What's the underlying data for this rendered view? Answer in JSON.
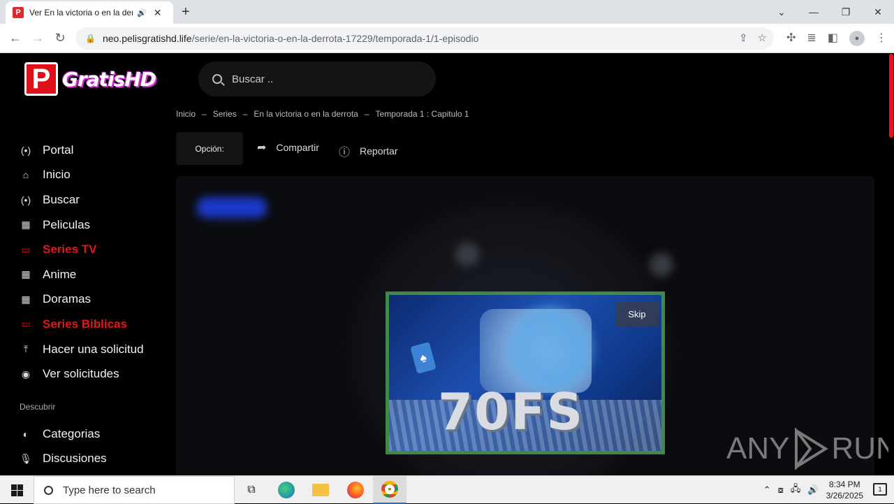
{
  "browser": {
    "tab_title": "Ver En la victoria o en la derrota",
    "favicon_letter": "P",
    "url_host": "neo.pelisgratishd.life",
    "url_path": "/serie/en-la-victoria-o-en-la-derrota-17229/temporada-1/1-episodio"
  },
  "site": {
    "logo_letter": "P",
    "logo_text": "GratisHD",
    "search_placeholder": "Buscar .."
  },
  "sidebar": {
    "items": [
      {
        "label": "Portal",
        "icon": "broadcast-icon",
        "glyph": "(•)"
      },
      {
        "label": "Inicio",
        "icon": "home-icon",
        "glyph": "⌂"
      },
      {
        "label": "Buscar",
        "icon": "broadcast-icon",
        "glyph": "(•)"
      },
      {
        "label": "Peliculas",
        "icon": "film-icon",
        "glyph": "▦"
      },
      {
        "label": "Series TV",
        "icon": "tv-icon",
        "glyph": "▭"
      },
      {
        "label": "Anime",
        "icon": "film-icon",
        "glyph": "▦"
      },
      {
        "label": "Doramas",
        "icon": "film-icon",
        "glyph": "▦"
      },
      {
        "label": "Series Biblicas",
        "icon": "tv-icon",
        "glyph": "▭"
      },
      {
        "label": "Hacer una solicitud",
        "icon": "upload-icon",
        "glyph": "⤒"
      },
      {
        "label": "Ver solicitudes",
        "icon": "eye-icon",
        "glyph": "◉"
      }
    ],
    "section_label": "Descubrir",
    "discover": [
      {
        "label": "Categorias",
        "icon": "half-circle-icon",
        "glyph": "◐"
      },
      {
        "label": "Discusiones",
        "icon": "microphone-icon",
        "glyph": "🎙"
      }
    ]
  },
  "breadcrumb": {
    "items": [
      "Inicio",
      "Series",
      "En la victoria o en la derrota",
      "Temporada 1 : Capitulo 1"
    ],
    "separator": "–"
  },
  "actions": {
    "option_label": "Opción:",
    "share_label": "Compartir",
    "report_label": "Reportar"
  },
  "ad": {
    "headline": "70FS",
    "skip_label": "Skip"
  },
  "watermark": {
    "left": "ANY",
    "right": "RUN"
  },
  "taskbar": {
    "search_placeholder": "Type here to search",
    "time": "8:34 PM",
    "date": "3/26/2025",
    "notification_count": "1"
  },
  "colors": {
    "accent_red": "#e8141c",
    "ad_border": "#3f8a49"
  }
}
